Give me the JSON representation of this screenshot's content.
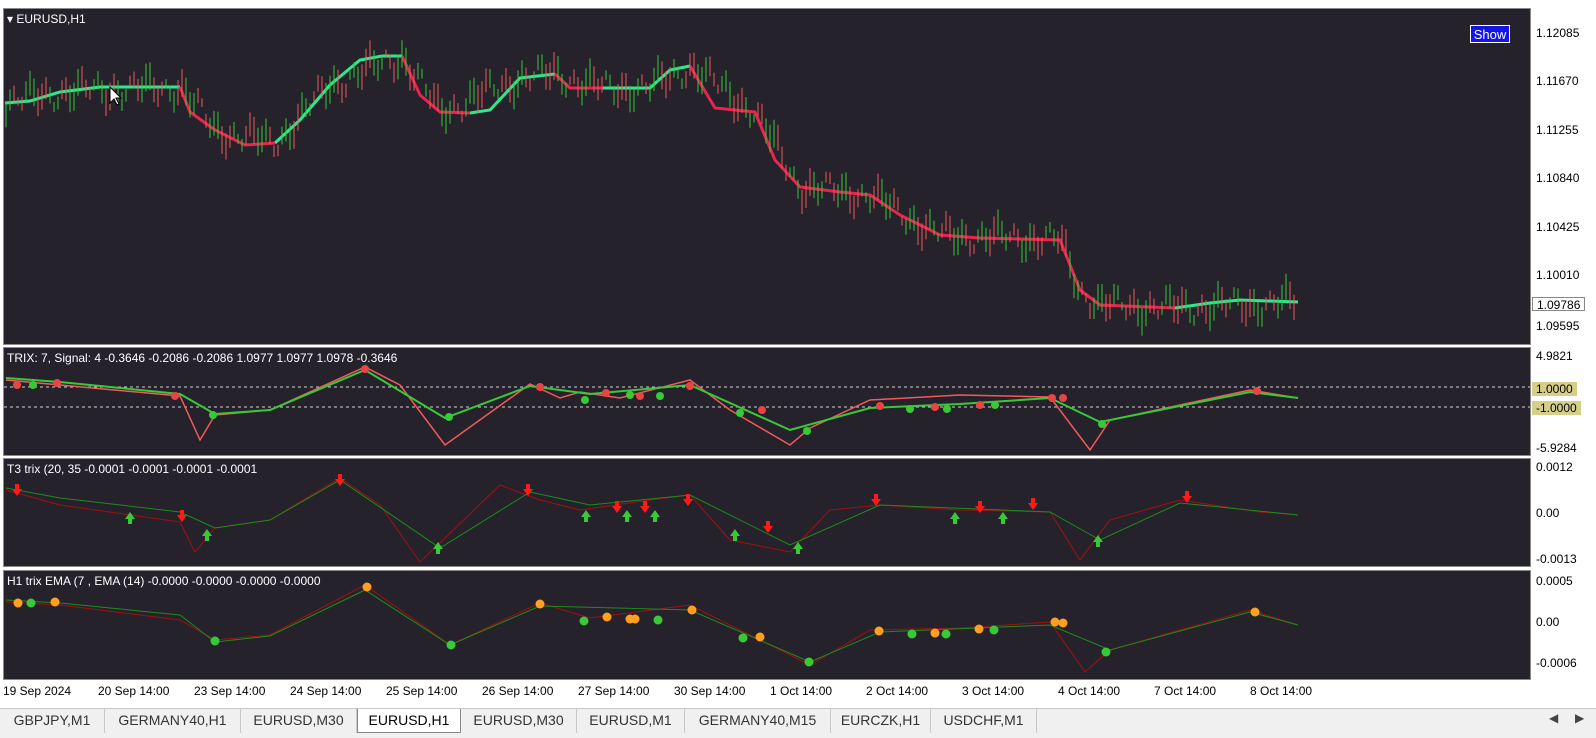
{
  "colors": {
    "bg": "#26222b",
    "up": "#2ee890",
    "down": "#e8244f",
    "trix_up": "#38c838",
    "trix_down": "#f05a5a",
    "green_dot": "#38c838",
    "red_dot": "#e84444",
    "orange_dot": "#ffa020",
    "dark_red": "#a01010",
    "dark_green": "#1c8c1c"
  },
  "main": {
    "symbol": "EURUSD,H1",
    "show_button": "Show",
    "axis": [
      "1.12085",
      "1.11670",
      "1.11255",
      "1.10840",
      "1.10425",
      "1.10010",
      "1.09595"
    ],
    "current_price": "1.09786"
  },
  "trix_panel": {
    "title": "TRIX: 7, Signal: 4 -0.3646 -0.2086 -0.2086 1.0977 1.0977 1.0978 -0.3646",
    "axis_top": "4.9821",
    "axis_bottom": "-5.9284",
    "level_hi": "1.0000",
    "level_lo": "-1.0000"
  },
  "t3_panel": {
    "title": "T3 trix (20, 35 -0.0001 -0.0001 -0.0001 -0.0001",
    "axis": [
      "0.0012",
      "0.00",
      "-0.0013"
    ]
  },
  "ema_panel": {
    "title": "H1 trix EMA (7 , EMA (14) -0.0000 -0.0000 -0.0000 -0.0000",
    "axis": [
      "0.0005",
      "0.00",
      "-0.0006"
    ]
  },
  "time_axis": [
    "19 Sep 2024",
    "20 Sep 14:00",
    "23 Sep 14:00",
    "24 Sep 14:00",
    "25 Sep 14:00",
    "26 Sep 14:00",
    "27 Sep 14:00",
    "30 Sep 14:00",
    "1 Oct 14:00",
    "2 Oct 14:00",
    "3 Oct 14:00",
    "4 Oct 14:00",
    "7 Oct 14:00",
    "8 Oct 14:00"
  ],
  "tabs": [
    "GBPJPY,M1",
    "GERMANY40,H1",
    "EURUSD,M30",
    "EURUSD,H1",
    "EURUSD,M30",
    "EURUSD,M1",
    "GERMANY40,M15",
    "EURCZK,H1",
    "USDCHF,M1"
  ],
  "active_tab": 3
}
